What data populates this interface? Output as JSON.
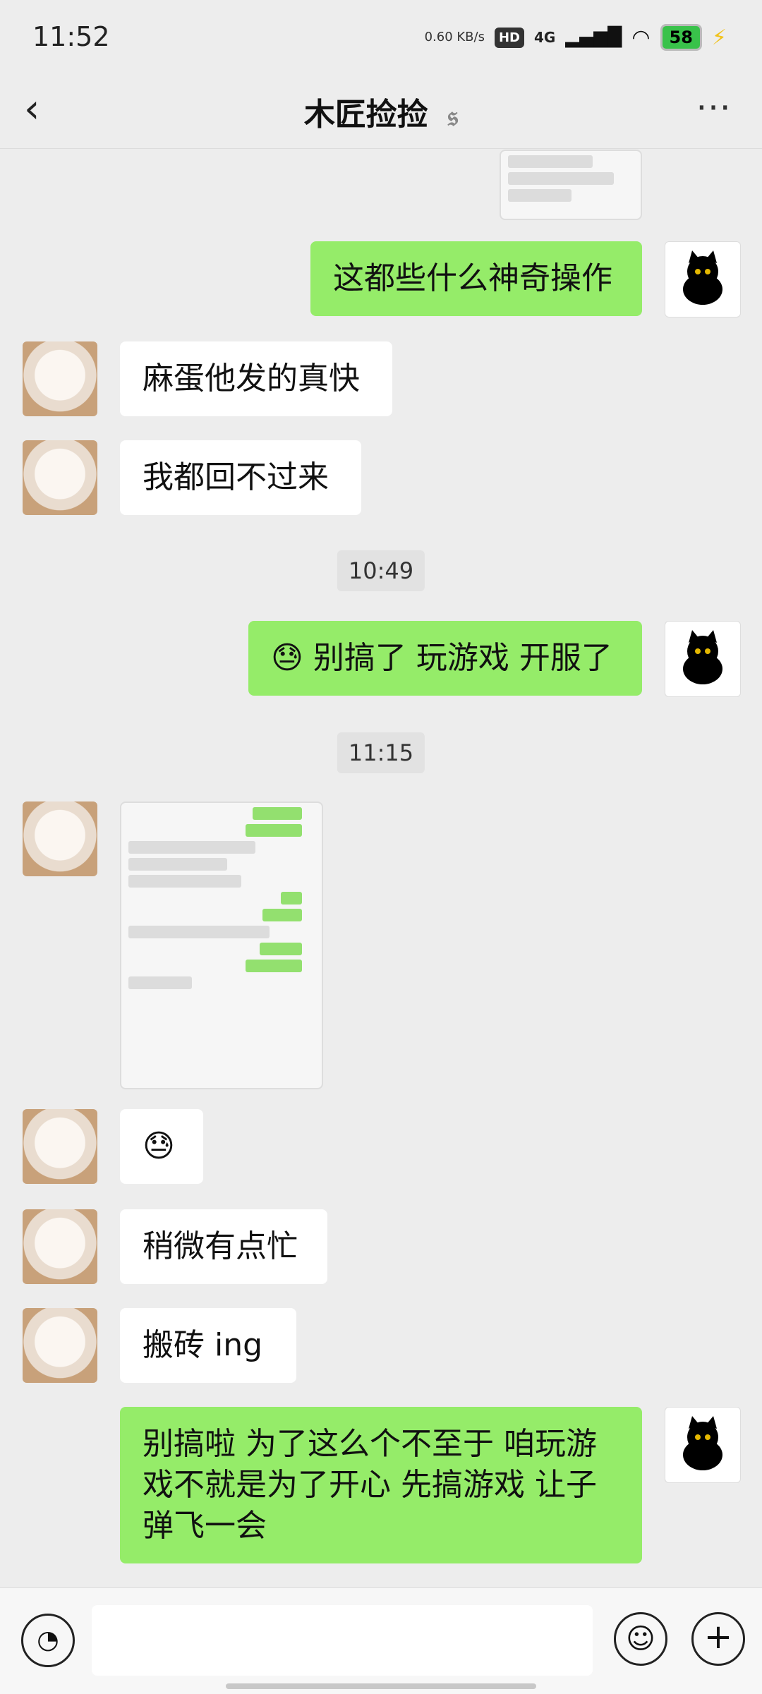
{
  "status": {
    "time": "11:52",
    "speed": "0.60\nKB/s",
    "hd": "HD",
    "network": "4G",
    "battery": "58",
    "charging_icon": "bolt"
  },
  "header": {
    "title": "木匠捡捡",
    "back_icon": "chevron-left",
    "ear_icon": "ear",
    "more_icon": "more-dots"
  },
  "messages": {
    "m1": "这都些什么神奇操作",
    "m2": "麻蛋他发的真快",
    "m3": "我都回不过来",
    "time1": "10:49",
    "m4_emoji": "😓",
    "m4": "别搞了 玩游戏 开服了",
    "time2": "11:15",
    "m5_emoji": "😓",
    "m6": "稍微有点忙",
    "m7": "搬砖 ing",
    "m8": "别搞啦 为了这么个不至于 咱玩游戏不就是为了开心 先搞游戏 让子弹飞一会"
  },
  "bottom": {
    "voice_icon": "voice",
    "emoji_icon": "smile",
    "plus_icon": "plus"
  }
}
